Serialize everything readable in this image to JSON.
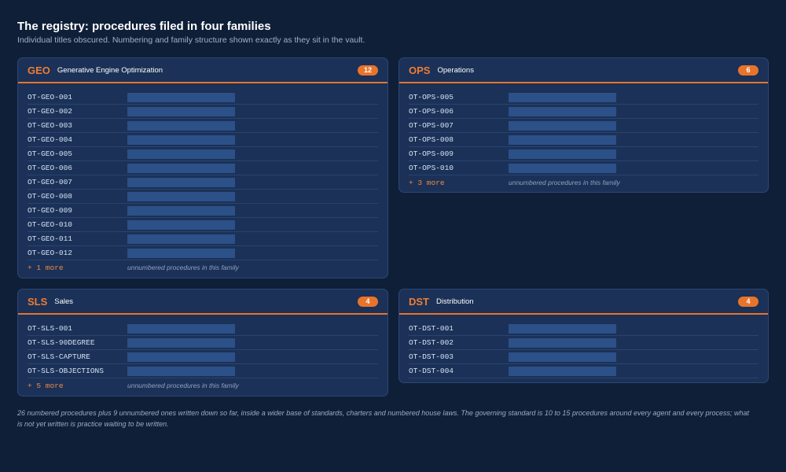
{
  "header": {
    "title": "The registry: procedures filed in four families",
    "subtitle": "Individual titles obscured. Numbering and family structure shown exactly as they sit in the vault."
  },
  "colors": {
    "background": "#0f1f38",
    "card": "#1b3157",
    "accent": "#e8742c",
    "redaction_bar": "#2c5088"
  },
  "families": [
    {
      "code": "GEO",
      "name": "Generative Engine Optimization",
      "count": "12",
      "items": [
        "OT-GEO-001",
        "OT-GEO-002",
        "OT-GEO-003",
        "OT-GEO-004",
        "OT-GEO-005",
        "OT-GEO-006",
        "OT-GEO-007",
        "OT-GEO-008",
        "OT-GEO-009",
        "OT-GEO-010",
        "OT-GEO-011",
        "OT-GEO-012"
      ],
      "more_label": "+ 1 more",
      "more_note": "unnumbered procedures in this family"
    },
    {
      "code": "OPS",
      "name": "Operations",
      "count": "6",
      "items": [
        "OT-OPS-005",
        "OT-OPS-006",
        "OT-OPS-007",
        "OT-OPS-008",
        "OT-OPS-009",
        "OT-OPS-010"
      ],
      "more_label": "+ 3 more",
      "more_note": "unnumbered procedures in this family"
    },
    {
      "code": "SLS",
      "name": "Sales",
      "count": "4",
      "items": [
        "OT-SLS-001",
        "OT-SLS-90DEGREE",
        "OT-SLS-CAPTURE",
        "OT-SLS-OBJECTIONS"
      ],
      "more_label": "+ 5 more",
      "more_note": "unnumbered procedures in this family"
    },
    {
      "code": "DST",
      "name": "Distribution",
      "count": "4",
      "items": [
        "OT-DST-001",
        "OT-DST-002",
        "OT-DST-003",
        "OT-DST-004"
      ],
      "more_label": "",
      "more_note": ""
    }
  ],
  "footnote": "26 numbered procedures plus 9 unnumbered ones written down so far, inside a wider base of standards, charters and numbered house laws. The governing standard is 10 to 15 procedures around every agent and every process; what is not yet written is practice waiting to be written."
}
